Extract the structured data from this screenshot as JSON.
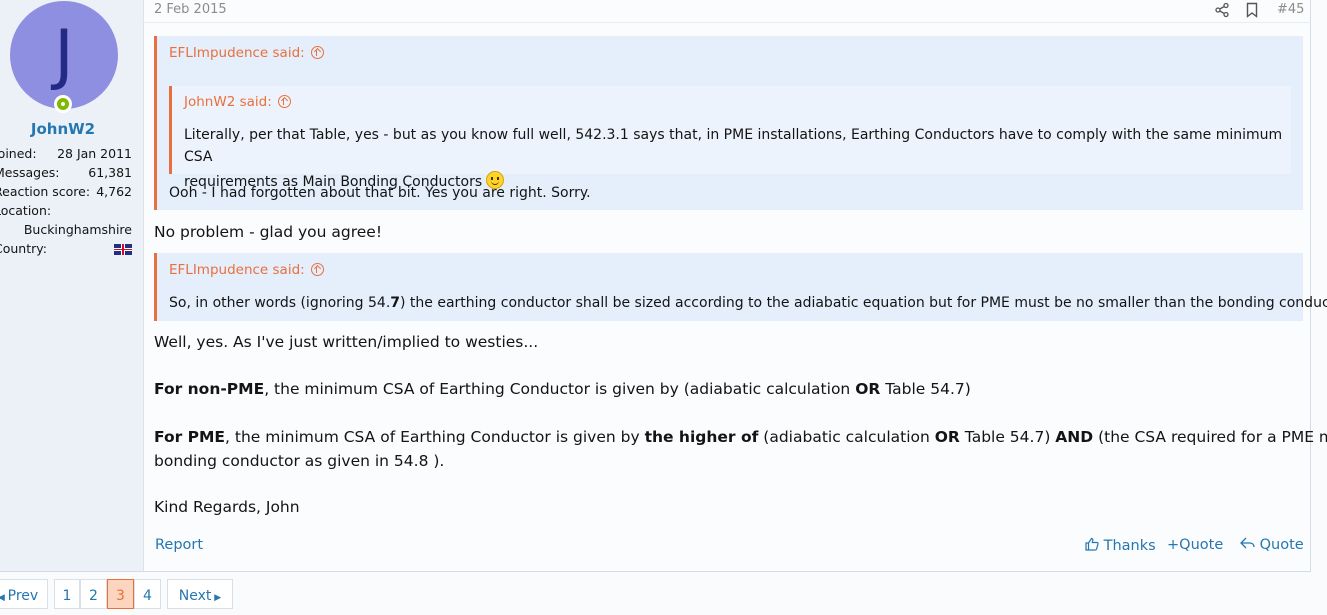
{
  "post": {
    "date": "2 Feb 2015",
    "number": "#45",
    "user": {
      "avatar_letter": "J",
      "username": "JohnW2",
      "stats": [
        {
          "label": "Joined:",
          "value": "28 Jan 2011"
        },
        {
          "label": "Messages:",
          "value": "61,381"
        },
        {
          "label": "Reaction score:",
          "value": "4,762"
        },
        {
          "label": "Location:",
          "value": ""
        },
        {
          "label": "",
          "value": "Buckinghamshire"
        },
        {
          "label": "Country:",
          "value": ""
        }
      ]
    },
    "quote1": {
      "author": "EFLImpudence said:",
      "nested": {
        "author": "JohnW2 said:",
        "text": "Literally, per that Table, yes - but as you know full well, 542.3.1 says that, in PME installations, Earthing Conductors have to comply with the same minimum CSA",
        "text2": "requirements as Main Bonding Conductors"
      },
      "reply": "Ooh - I had forgotten about that bit. Yes you are right. Sorry."
    },
    "reply1": "No problem - glad you agree!",
    "quote2": {
      "author": "EFLImpudence said:",
      "text_a": "So, in other words (ignoring 54.",
      "text_b": "7",
      "text_c": ") the earthing conductor shall be sized according to the adiabatic equation but for PME must be no smaller than the bonding conductor."
    },
    "body": {
      "p1": "Well, yes. As I've just written/implied to westies...",
      "p2_b1": "For non-PME",
      "p2_t1": ", the minimum CSA of Earthing Conductor is given by (adiabatic calculation ",
      "p2_b2": "OR",
      "p2_t2": " Table 54.7)",
      "p3_b1": "For PME",
      "p3_t1": ", the minimum CSA of Earthing Conductor is given by ",
      "p3_b2": "the higher of",
      "p3_t2": " (adiabatic calculation ",
      "p3_b3": "OR",
      "p3_t3": " Table 54.7) ",
      "p3_b4": "AND",
      "p3_t4": " (the CSA required for a PME main",
      "p3_line2": "bonding conductor as given in 54.8 ).",
      "p4": "Kind Regards, John"
    },
    "actions": {
      "report": "Report",
      "thanks": "Thanks",
      "multiquote": "Quote",
      "quote": "Quote"
    }
  },
  "pagination": {
    "prev": "Prev",
    "pages": [
      "1",
      "2",
      "3",
      "4"
    ],
    "current": "3",
    "next": "Next"
  },
  "colors": {
    "accent": "#e8703c",
    "link": "#2577b1",
    "quote_bg": "#e5eefb",
    "avatar_bg": "#8e8fe0"
  }
}
